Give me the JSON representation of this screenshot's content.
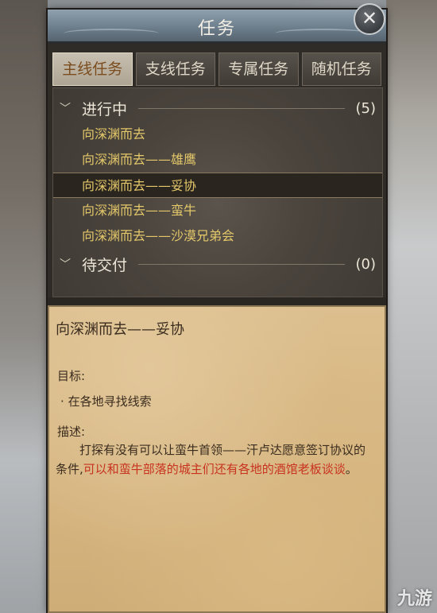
{
  "window": {
    "title": "任务"
  },
  "tabs": [
    {
      "label": "主线任务",
      "active": true
    },
    {
      "label": "支线任务",
      "active": false
    },
    {
      "label": "专属任务",
      "active": false
    },
    {
      "label": "随机任务",
      "active": false
    }
  ],
  "groups": {
    "in_progress": {
      "label": "进行中",
      "count": "(5)"
    },
    "pending": {
      "label": "待交付",
      "count": "(0)"
    }
  },
  "quests": [
    {
      "name": "向深渊而去",
      "selected": false
    },
    {
      "name": "向深渊而去——雄鹰",
      "selected": false
    },
    {
      "name": "向深渊而去——妥协",
      "selected": true
    },
    {
      "name": "向深渊而去——蛮牛",
      "selected": false
    },
    {
      "name": "向深渊而去——沙漠兄弟会",
      "selected": false
    }
  ],
  "detail": {
    "title": "向深渊而去——妥协",
    "goal_label": "目标:",
    "goal_item": "在各地寻找线索",
    "desc_label": "描述:",
    "desc_plain": "打探有没有可以让蛮牛首领——汗卢达愿意签订协议的条件,",
    "desc_highlight": "可以和蛮牛部落的城主们还有各地的酒馆老板谈谈",
    "desc_end": "。"
  },
  "icons": {
    "close": "close-icon",
    "chevron": "chevron-down-icon",
    "bullet": "bullet-icon"
  },
  "colors": {
    "quest_text": "#e4c86a",
    "highlight_red": "#c8321e",
    "active_tab_text": "#7a4c1e"
  },
  "watermark": "九游"
}
